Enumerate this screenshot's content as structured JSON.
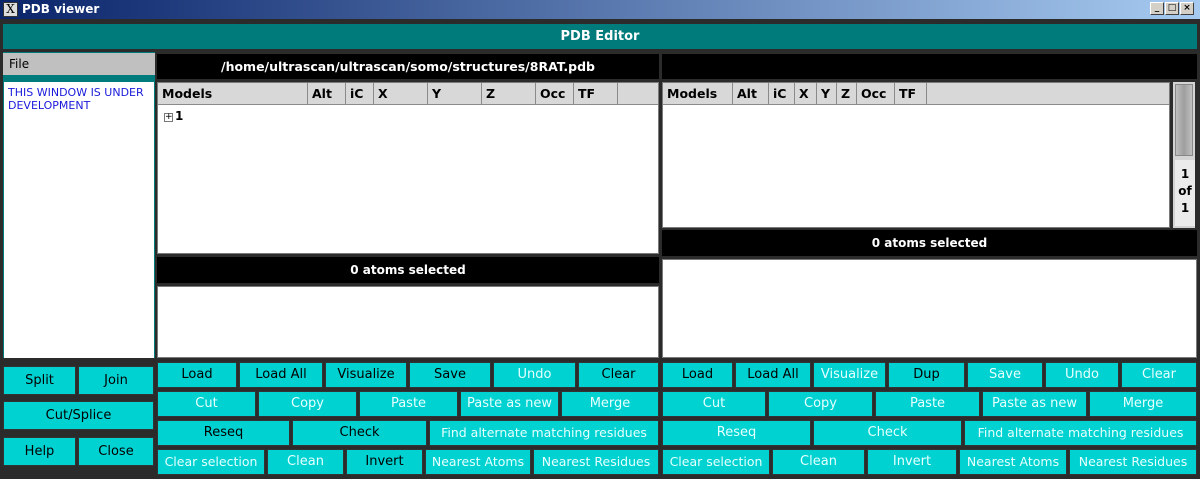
{
  "window": {
    "title": "PDB viewer",
    "app_icon": "x-logo-icon",
    "controls": [
      "_",
      "□",
      "×"
    ]
  },
  "header": {
    "title": "PDB Editor"
  },
  "left_panel": {
    "file_menu": "File",
    "dev_notice": "THIS WINDOW IS UNDER DEVELOPMENT",
    "buttons": {
      "split": "Split",
      "join": "Join",
      "cut_splice": "Cut/Splice",
      "help": "Help",
      "close": "Close"
    }
  },
  "pane1": {
    "path": "/home/ultrascan/ultrascan/somo/structures/8RAT.pdb",
    "columns": [
      "Models",
      "Alt",
      "iC",
      "X",
      "Y",
      "Z",
      "Occ",
      "TF"
    ],
    "rows": [
      {
        "expander": "+",
        "label": "1"
      }
    ],
    "selected": "0 atoms selected",
    "row1": [
      "Load",
      "Load All",
      "Visualize",
      "Save",
      "Undo",
      "Clear"
    ],
    "row2": [
      "Cut",
      "Copy",
      "Paste",
      "Paste as new",
      "Merge"
    ],
    "row3": [
      "Reseq",
      "Check",
      "Find alternate matching residues"
    ],
    "row4": [
      "Clear selection",
      "Clean",
      "Invert",
      "Nearest Atoms",
      "Nearest Residues"
    ]
  },
  "pane2": {
    "path": "",
    "columns": [
      "Models",
      "Alt",
      "iC",
      "X",
      "Y",
      "Z",
      "Occ",
      "TF"
    ],
    "page_indicator": [
      "1",
      "of",
      "1"
    ],
    "selected": "0 atoms selected",
    "row1": [
      "Load",
      "Load All",
      "Visualize",
      "Dup",
      "Save",
      "Undo",
      "Clear"
    ],
    "row2": [
      "Cut",
      "Copy",
      "Paste",
      "Paste as new",
      "Merge"
    ],
    "row3": [
      "Reseq",
      "Check",
      "Find alternate matching residues"
    ],
    "row4": [
      "Clear selection",
      "Clean",
      "Invert",
      "Nearest Atoms",
      "Nearest Residues"
    ]
  },
  "colors": {
    "teal": "#007b7b",
    "button": "#00d2d2",
    "bar": "#000000"
  }
}
